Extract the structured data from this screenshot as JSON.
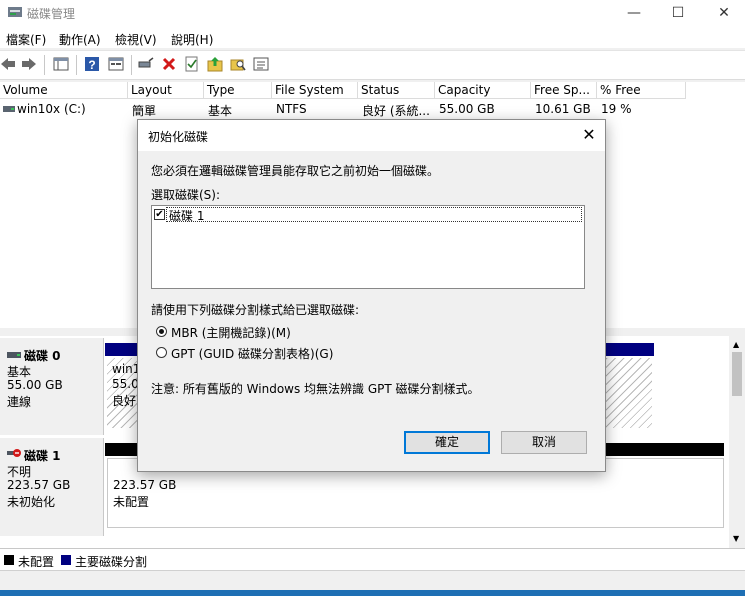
{
  "window": {
    "title": "磁碟管理",
    "controls": {
      "minimize": "—",
      "maximize": "☐",
      "close": "✕"
    }
  },
  "menu": [
    "檔案(F)",
    "動作(A)",
    "檢視(V)",
    "說明(H)"
  ],
  "volume_table": {
    "columns": [
      "Volume",
      "Layout",
      "Type",
      "File System",
      "Status",
      "Capacity",
      "Free Sp...",
      "% Free"
    ],
    "rows": [
      {
        "volume": "win10x (C:)",
        "layout": "簡單",
        "type": "基本",
        "fs": "NTFS",
        "status": "良好 (系統...",
        "capacity": "55.00 GB",
        "free": "10.61 GB",
        "pct": "19 %"
      }
    ]
  },
  "disks": [
    {
      "name": "磁碟 0",
      "type": "基本",
      "size": "55.00 GB",
      "state": "連線",
      "partition": {
        "name": "win1",
        "size": "55.0",
        "status": "良好"
      }
    },
    {
      "name": "磁碟 1",
      "type": "不明",
      "size": "223.57 GB",
      "state": "未初始化",
      "partition": {
        "size": "223.57 GB",
        "status": "未配置"
      }
    }
  ],
  "legend": {
    "unallocated": "未配置",
    "primary": "主要磁碟分割"
  },
  "colors": {
    "primary": "#000080",
    "unallocated": "#000000",
    "accent": "#0078d7"
  },
  "dialog": {
    "title": "初始化磁碟",
    "intro": "您必須在邏輯磁碟管理員能存取它之前初始一個磁碟。",
    "select_label": "選取磁碟(S):",
    "disk_item": "磁碟 1",
    "style_label": "請使用下列磁碟分割樣式給已選取磁碟:",
    "mbr": "MBR (主開機記錄)(M)",
    "gpt": "GPT (GUID 磁碟分割表格)(G)",
    "note": "注意: 所有舊版的 Windows 均無法辨識 GPT 磁碟分割樣式。",
    "ok": "確定",
    "cancel": "取消"
  }
}
